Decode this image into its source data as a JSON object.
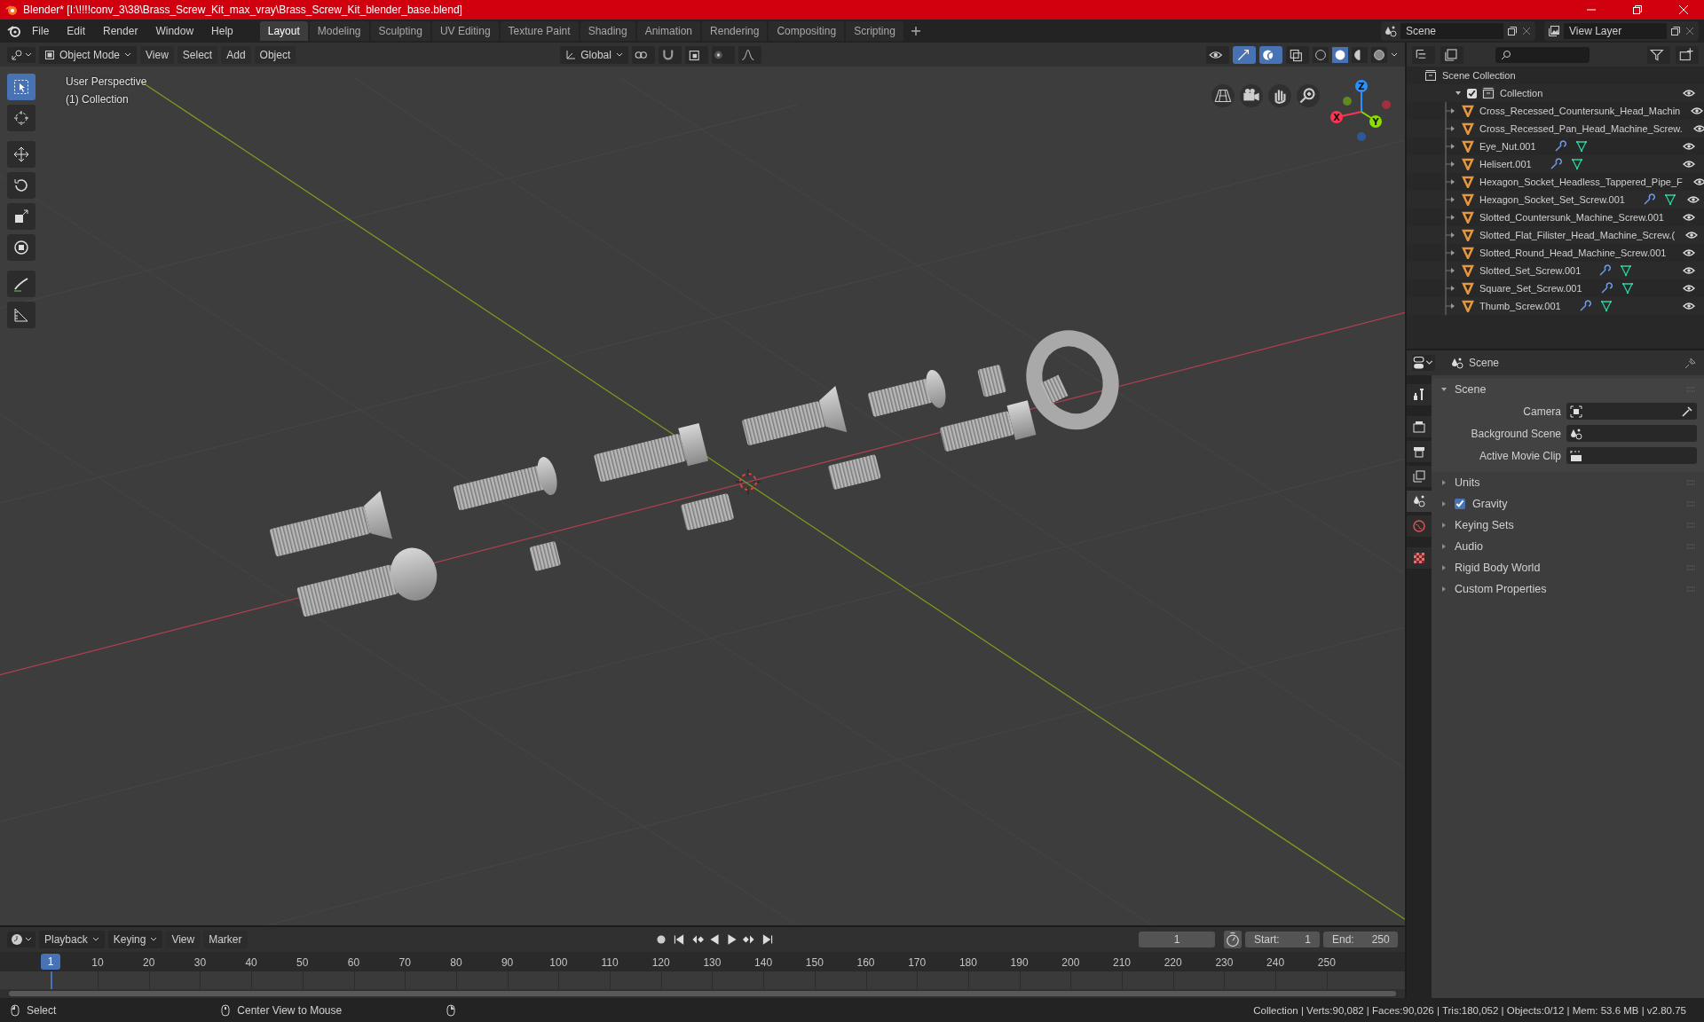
{
  "title_bar": {
    "title": "Blender* [I:\\!!!!conv_3\\38\\Brass_Screw_Kit_max_vray\\Brass_Screw_Kit_blender_base.blend]"
  },
  "menu": [
    "File",
    "Edit",
    "Render",
    "Window",
    "Help"
  ],
  "workspaces": [
    {
      "label": "Layout",
      "selected": true
    },
    {
      "label": "Modeling",
      "selected": false
    },
    {
      "label": "Sculpting",
      "selected": false
    },
    {
      "label": "UV Editing",
      "selected": false
    },
    {
      "label": "Texture Paint",
      "selected": false
    },
    {
      "label": "Shading",
      "selected": false
    },
    {
      "label": "Animation",
      "selected": false
    },
    {
      "label": "Rendering",
      "selected": false
    },
    {
      "label": "Compositing",
      "selected": false
    },
    {
      "label": "Scripting",
      "selected": false
    }
  ],
  "scene_selector": {
    "value": "Scene"
  },
  "view_layer_selector": {
    "value": "View Layer"
  },
  "viewport_header": {
    "mode": "Object Mode",
    "menus": [
      "View",
      "Select",
      "Add",
      "Object"
    ],
    "orientation": "Global",
    "shading_modes": [
      {
        "kind": "wireframe",
        "selected": false
      },
      {
        "kind": "solid",
        "selected": true
      },
      {
        "kind": "material",
        "selected": false
      },
      {
        "kind": "rendered",
        "selected": false
      }
    ]
  },
  "tools": [
    {
      "kind": "select",
      "selected": true
    },
    {
      "kind": "cursor",
      "selected": false
    },
    {
      "kind": "move",
      "selected": false
    },
    {
      "kind": "rotate",
      "selected": false
    },
    {
      "kind": "scale",
      "selected": false
    },
    {
      "kind": "transform",
      "selected": false
    },
    {
      "kind": "annotate",
      "selected": false
    },
    {
      "kind": "measure",
      "selected": false
    }
  ],
  "viewport": {
    "overlay_lines": [
      "User Perspective",
      "(1) Collection"
    ],
    "gizmo_axes": [
      {
        "label": "X",
        "color": "#ff3352"
      },
      {
        "label": "Y",
        "color": "#8bdc00"
      },
      {
        "label": "Z",
        "color": "#2890ff"
      }
    ]
  },
  "outliner": {
    "root": "Scene Collection",
    "collection": {
      "label": "Collection",
      "checked": true,
      "expanded": true,
      "children": [
        {
          "label": "Cross_Recessed_Countersunk_Head_Machin",
          "modifiers": false
        },
        {
          "label": "Cross_Recessed_Pan_Head_Machine_Screw.",
          "modifiers": false
        },
        {
          "label": "Eye_Nut.001",
          "modifiers": true
        },
        {
          "label": "Helisert.001",
          "modifiers": true
        },
        {
          "label": "Hexagon_Socket_Headless_Tappered_Pipe_F",
          "modifiers": false
        },
        {
          "label": "Hexagon_Socket_Set_Screw.001",
          "modifiers": true
        },
        {
          "label": "Slotted_Countersunk_Machine_Screw.001",
          "modifiers": false
        },
        {
          "label": "Slotted_Flat_Filister_Head_Machine_Screw.(",
          "modifiers": false
        },
        {
          "label": "Slotted_Round_Head_Machine_Screw.001",
          "modifiers": false
        },
        {
          "label": "Slotted_Set_Screw.001",
          "modifiers": true
        },
        {
          "label": "Square_Set_Screw.001",
          "modifiers": true
        },
        {
          "label": "Thumb_Screw.001",
          "modifiers": true
        }
      ]
    }
  },
  "properties": {
    "context": "Scene",
    "tabs": [
      {
        "kind": "tool",
        "selected": false
      },
      {
        "kind": "render",
        "selected": false
      },
      {
        "kind": "output",
        "selected": false
      },
      {
        "kind": "view_layer",
        "selected": false
      },
      {
        "kind": "scene",
        "selected": true
      },
      {
        "kind": "world",
        "selected": false
      },
      {
        "kind": "texture",
        "selected": false
      }
    ],
    "panel": {
      "title": "Scene",
      "expanded": true,
      "fields": [
        {
          "label": "Camera",
          "kind": "camera"
        },
        {
          "label": "Background Scene",
          "kind": "scene"
        },
        {
          "label": "Active Movie Clip",
          "kind": "clip"
        }
      ]
    },
    "sections": [
      {
        "label": "Units",
        "kind": "plain"
      },
      {
        "label": "Gravity",
        "kind": "checkbox",
        "checked": true
      },
      {
        "label": "Keying Sets",
        "kind": "plain"
      },
      {
        "label": "Audio",
        "kind": "plain"
      },
      {
        "label": "Rigid Body World",
        "kind": "plain"
      },
      {
        "label": "Custom Properties",
        "kind": "plain"
      }
    ]
  },
  "timeline": {
    "menus": [
      "Playback",
      "Keying",
      "View",
      "Marker"
    ],
    "current_frame": "1",
    "start_label": "Start:",
    "start": "1",
    "end_label": "End:",
    "end": "250",
    "playhead": "1",
    "ticks": [
      "10",
      "20",
      "30",
      "40",
      "50",
      "60",
      "70",
      "80",
      "90",
      "100",
      "110",
      "120",
      "130",
      "140",
      "150",
      "160",
      "170",
      "180",
      "190",
      "200",
      "210",
      "220",
      "230",
      "240",
      "250"
    ]
  },
  "status_bar": {
    "hints": [
      "Select",
      "Center View to Mouse"
    ],
    "stats": "Collection | Verts:90,082 | Faces:90,026 | Tris:180,052 | Objects:0/12 | Mem: 53.6 MB | v2.80.75"
  }
}
